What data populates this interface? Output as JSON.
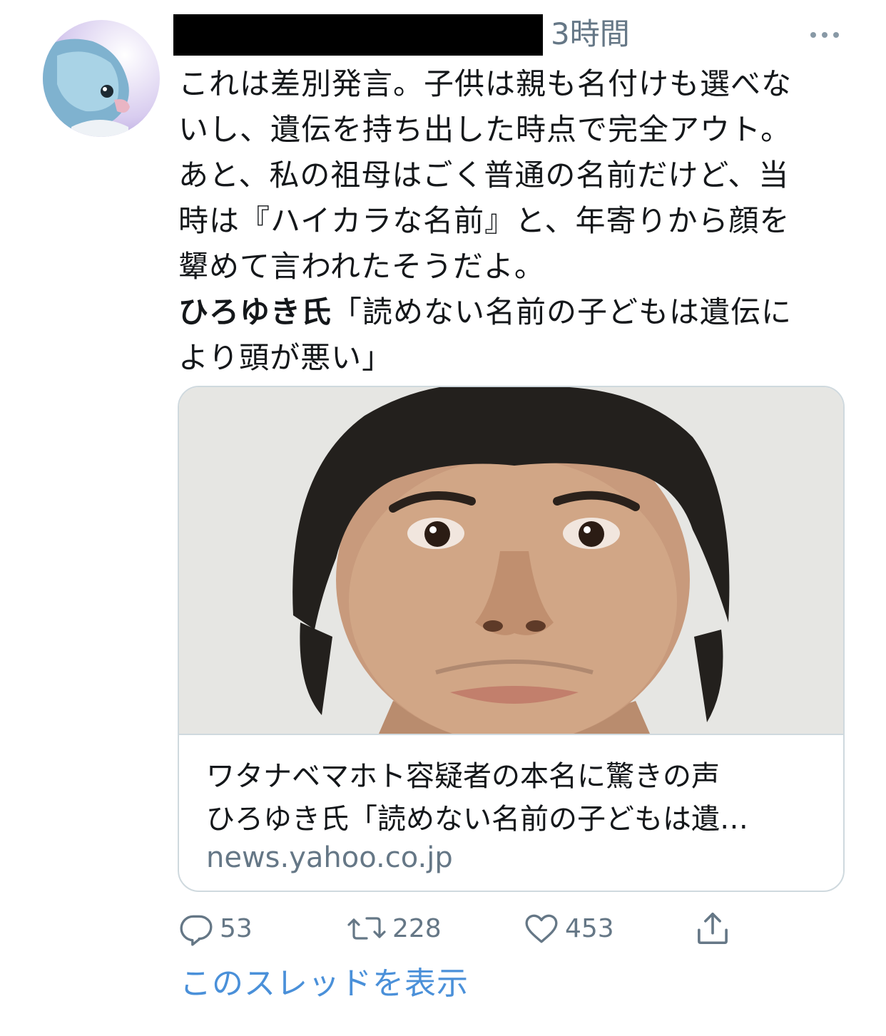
{
  "tweet": {
    "author_name_redacted": true,
    "time": "3時間",
    "text_lines": [
      "これは差別発言。子供は親も名付けも選べな",
      "いし、遺伝を持ち出した時点で完全アウト。",
      "あと、私の祖母はごく普通の名前だけど、当",
      "時は『ハイカラな名前』と、年寄りから顔を",
      "顰めて言われたそうだよ。"
    ],
    "quote_bold": "ひろゆき氏",
    "quote_rest_line1": "「読めない名前の子どもは遺伝に",
    "quote_line2": "より頭が悪い」"
  },
  "card": {
    "title_line1": "ワタナベマホト容疑者の本名に驚きの声",
    "title_line2": "ひろゆき氏「読めない名前の子どもは遺…",
    "domain": "news.yahoo.co.jp"
  },
  "actions": {
    "reply_count": "53",
    "retweet_count": "228",
    "like_count": "453"
  },
  "thread_link": "このスレッドを表示",
  "colors": {
    "secondary_text": "#657786",
    "link": "#4a90d9",
    "border": "#cfd9de"
  },
  "icons": [
    "more-icon",
    "reply-icon",
    "retweet-icon",
    "like-icon",
    "share-icon"
  ]
}
